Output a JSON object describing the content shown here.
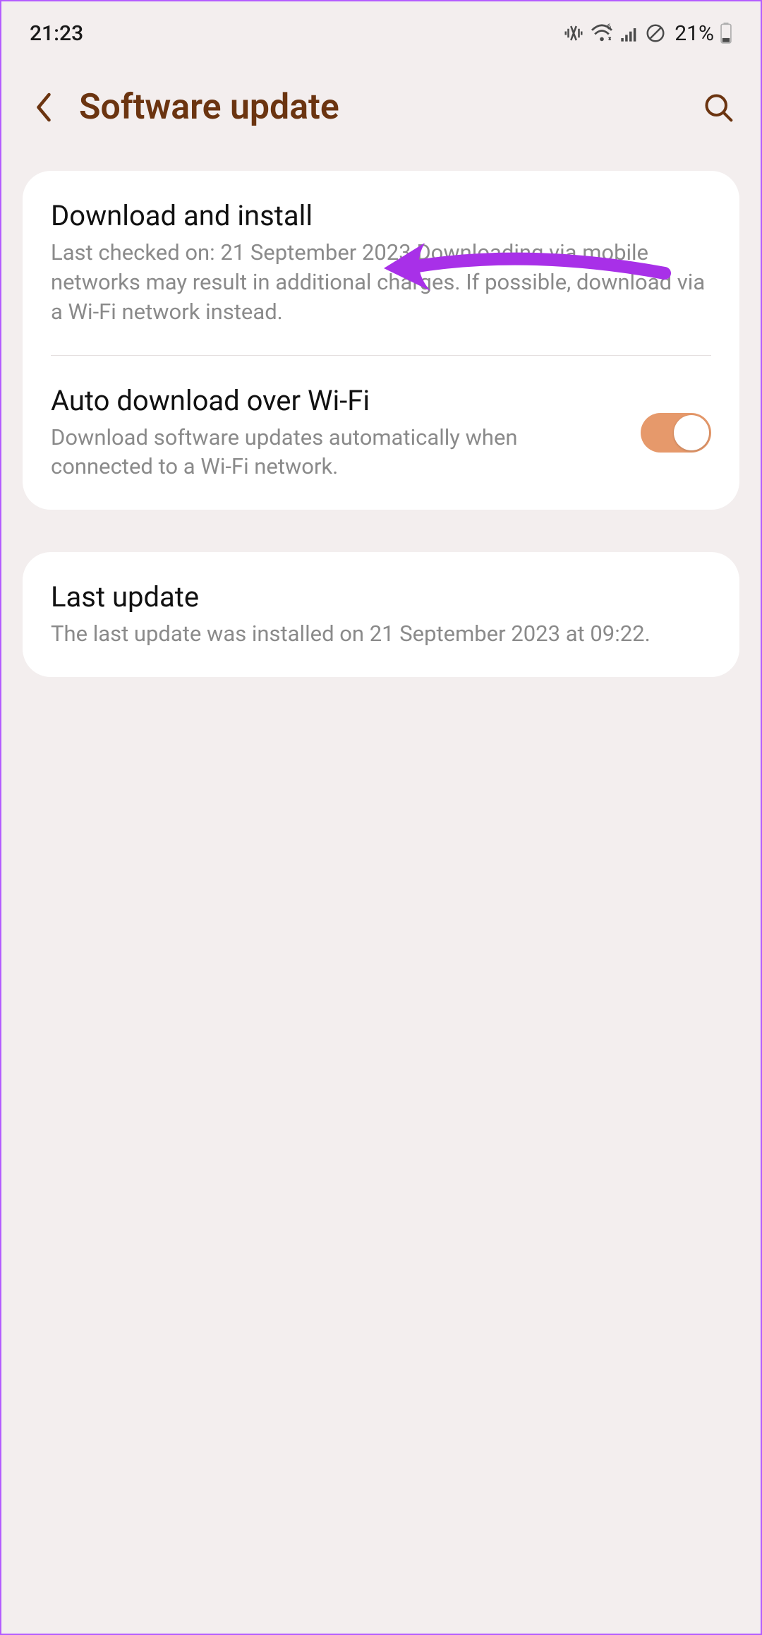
{
  "statusbar": {
    "time": "21:23",
    "battery_text": "21%"
  },
  "header": {
    "title": "Software update"
  },
  "download_install": {
    "title": "Download and install",
    "subtitle": "Last checked on: 21 September 2023\nDownloading via mobile networks may result in additional charges. If possible, download via a Wi-Fi network instead."
  },
  "auto_download": {
    "title": "Auto download over Wi-Fi",
    "subtitle": "Download software updates automatically when connected to a Wi-Fi network.",
    "enabled": true
  },
  "last_update": {
    "title": "Last update",
    "subtitle": "The last update was installed on 21 September 2023 at 09:22."
  }
}
